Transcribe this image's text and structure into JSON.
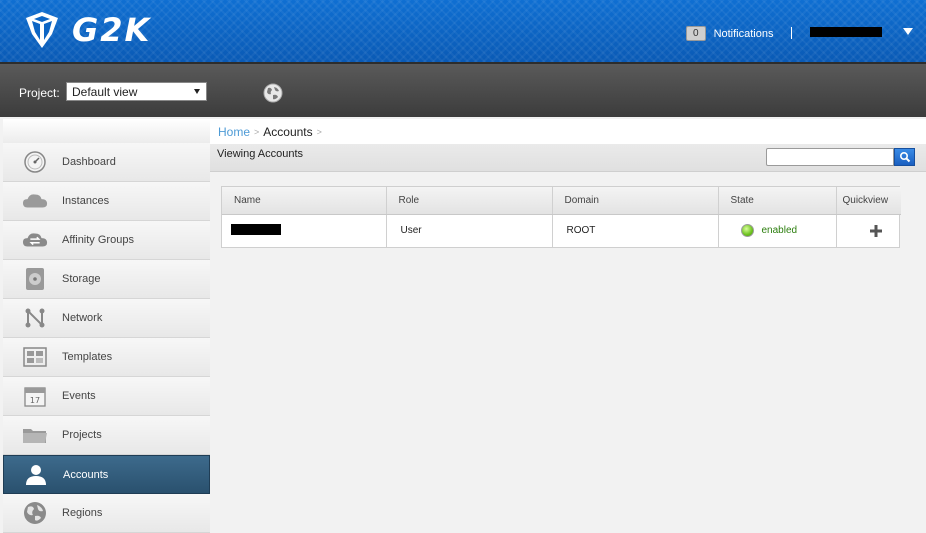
{
  "header": {
    "logo_text": "G2K",
    "notifications_count": "0",
    "notifications_label": "Notifications"
  },
  "projectbar": {
    "label": "Project:",
    "selected": "Default view"
  },
  "sidebar": {
    "items": [
      {
        "label": "Dashboard",
        "icon": "dashboard-icon"
      },
      {
        "label": "Instances",
        "icon": "cloud-icon"
      },
      {
        "label": "Affinity Groups",
        "icon": "affinity-icon"
      },
      {
        "label": "Storage",
        "icon": "disk-icon"
      },
      {
        "label": "Network",
        "icon": "network-icon"
      },
      {
        "label": "Templates",
        "icon": "templates-icon"
      },
      {
        "label": "Events",
        "icon": "calendar-icon"
      },
      {
        "label": "Projects",
        "icon": "folder-icon"
      },
      {
        "label": "Accounts",
        "icon": "user-icon"
      },
      {
        "label": "Regions",
        "icon": "globe-icon"
      }
    ],
    "active": "Accounts",
    "calendar_day": "17"
  },
  "breadcrumb": {
    "home": "Home",
    "current": "Accounts"
  },
  "subbar": {
    "title": "Viewing Accounts",
    "search_placeholder": ""
  },
  "table": {
    "columns": [
      "Name",
      "Role",
      "Domain",
      "State",
      "Quickview"
    ],
    "rows": [
      {
        "name": "",
        "role": "User",
        "domain": "ROOT",
        "state": "enabled"
      }
    ]
  },
  "colors": {
    "header_blue": "#0f6fd2",
    "active_nav": "#2f5a7a",
    "link_blue": "#4e9bd6",
    "state_green": "#2c7e0e"
  }
}
